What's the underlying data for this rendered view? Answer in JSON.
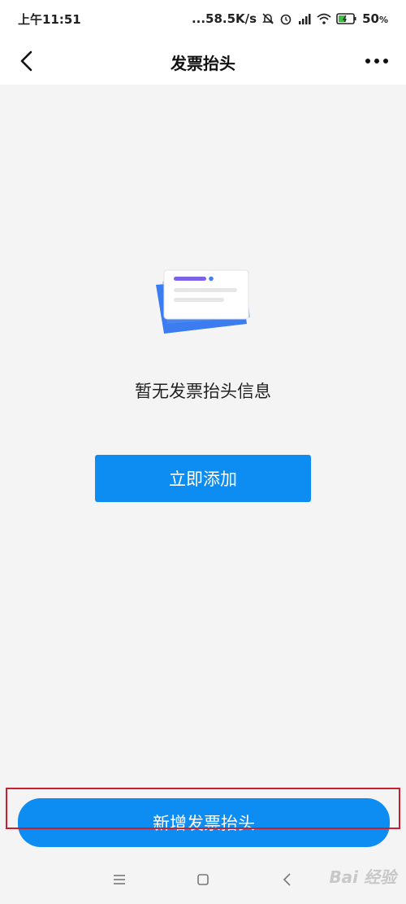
{
  "status_bar": {
    "time": "上午11:51",
    "network_speed": "...58.5K/s",
    "battery_percent": "50",
    "battery_unit": "%",
    "icons": [
      "mute-bell-icon",
      "alarm-icon",
      "hd-signal-icon",
      "wifi-icon",
      "battery-charging-icon"
    ]
  },
  "nav": {
    "title": "发票抬头",
    "back_icon": "chevron-left-icon",
    "more_icon": "more-dots-icon"
  },
  "empty_state": {
    "illustration": "invoice-cards-illustration",
    "message": "暂无发票抬头信息",
    "add_button_label": "立即添加"
  },
  "footer": {
    "new_button_label": "新增发票抬头"
  },
  "system_nav": {
    "icons": [
      "menu-icon",
      "home-icon",
      "back-icon"
    ]
  },
  "watermark": {
    "text": "Bai 经验"
  },
  "colors": {
    "accent": "#0d8cf2",
    "highlight_border": "#c8202f",
    "background": "#f4f4f4"
  }
}
